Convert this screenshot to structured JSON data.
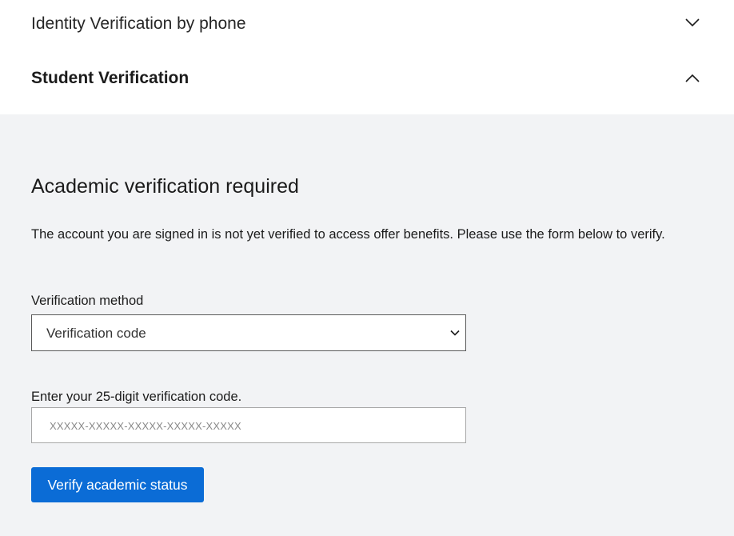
{
  "accordion": {
    "sections": [
      {
        "title": "Identity Verification by phone",
        "expanded": false
      },
      {
        "title": "Student Verification",
        "expanded": true
      }
    ]
  },
  "student_panel": {
    "heading": "Academic verification required",
    "description": "The account you are signed in is not yet verified to access offer benefits. Please use the form below to verify.",
    "method_label": "Verification method",
    "method_selected": "Verification code",
    "code_label": "Enter your 25-digit verification code.",
    "code_placeholder": "XXXXX-XXXXX-XXXXX-XXXXX-XXXXX",
    "submit_label": "Verify academic status"
  },
  "colors": {
    "panel_background": "#f2f3f5",
    "button_background": "#0b6cd6",
    "button_text": "#ffffff"
  },
  "icons": {
    "collapsed": "chevron-down-icon",
    "expanded": "chevron-up-icon",
    "select": "chevron-down-icon"
  }
}
